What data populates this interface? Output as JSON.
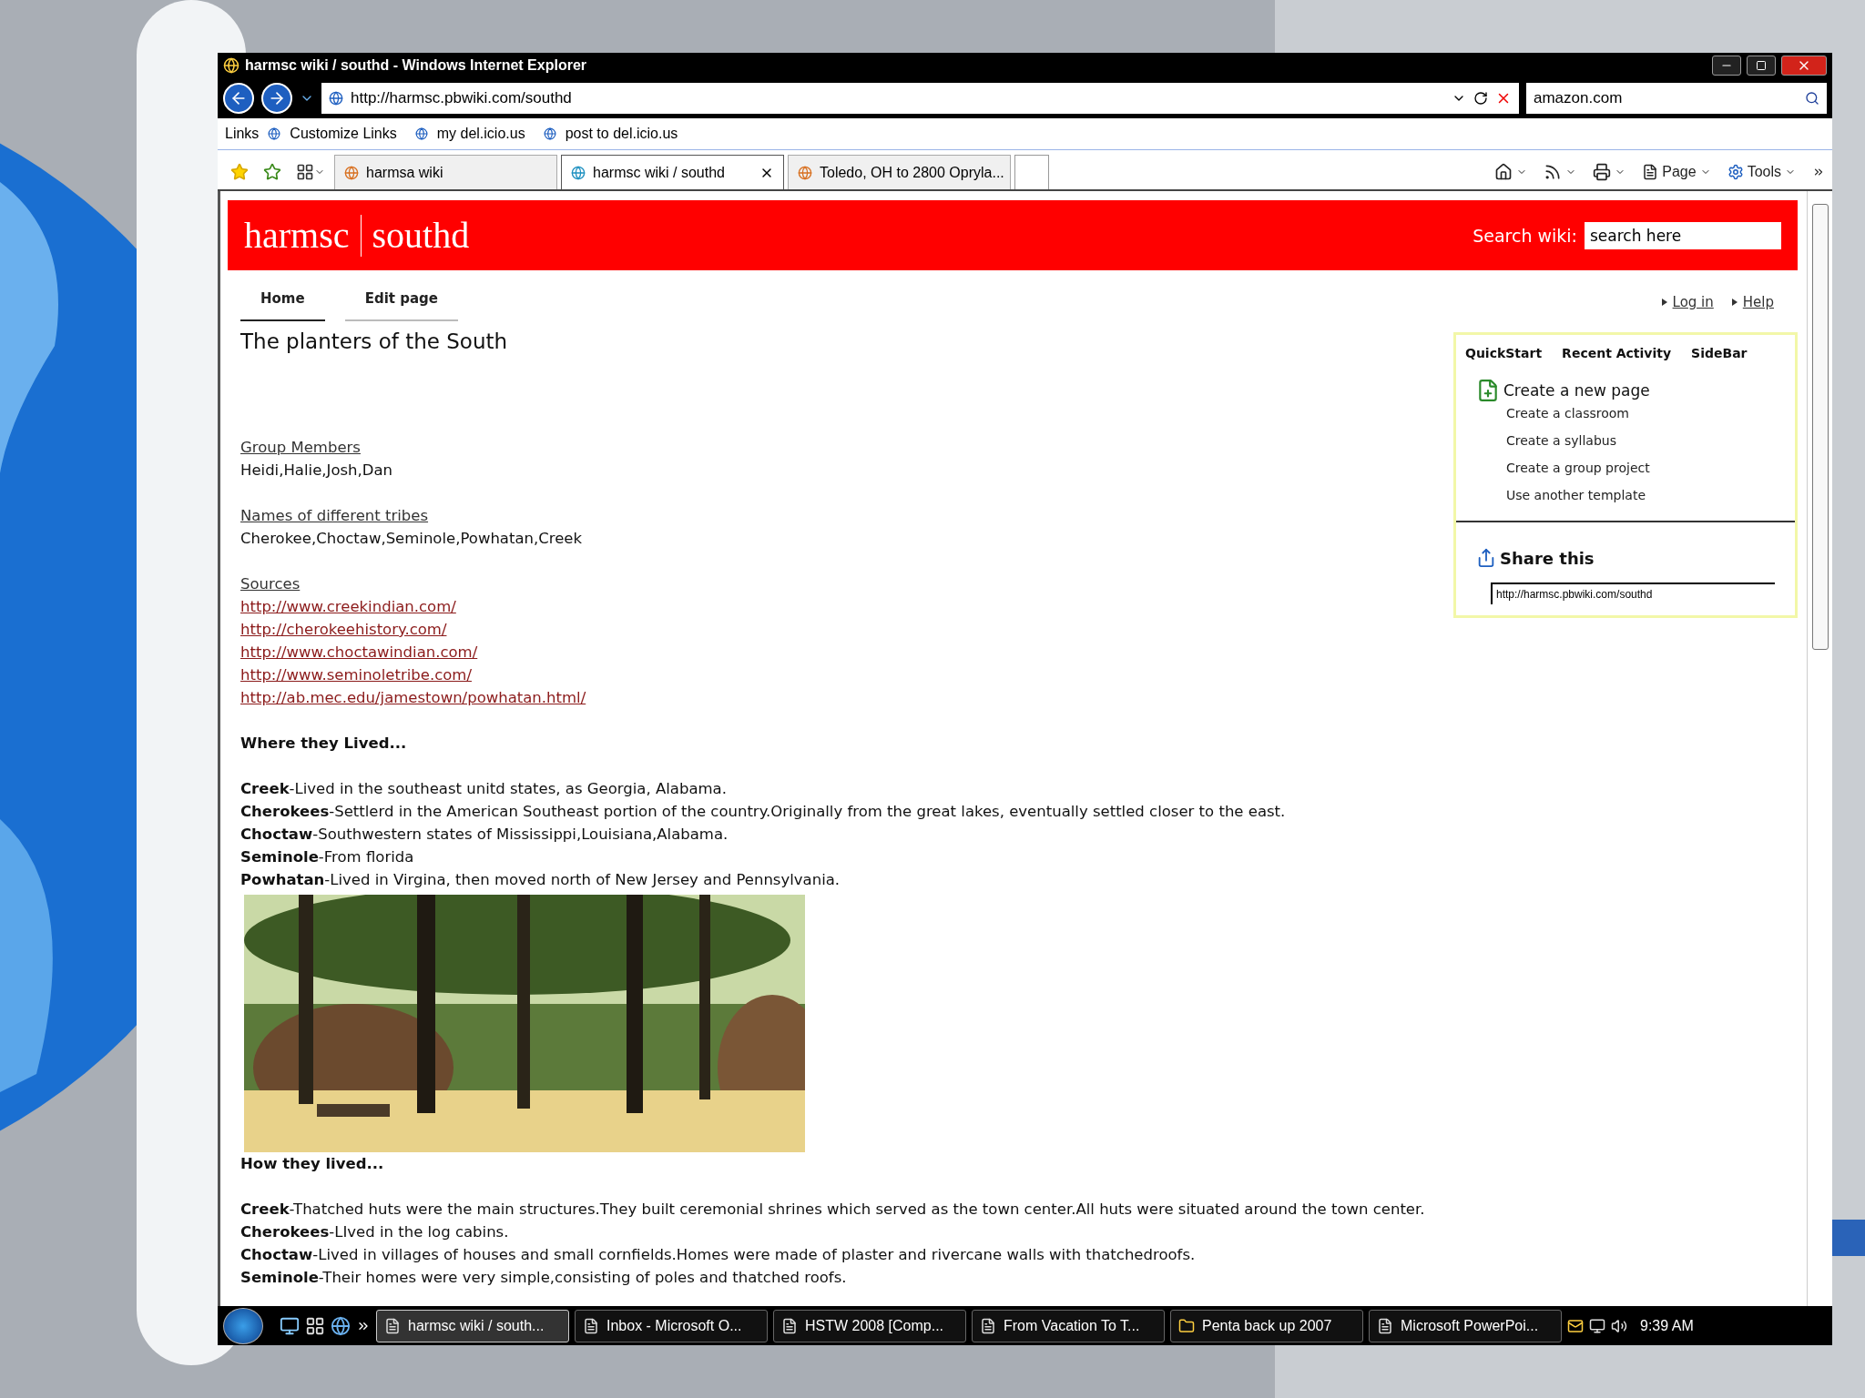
{
  "window": {
    "title": "harmsc wiki / southd - Windows Internet Explorer"
  },
  "address_bar": {
    "url": "http://harmsc.pbwiki.com/southd",
    "search_value": "amazon.com"
  },
  "links_bar": {
    "label": "Links",
    "links": [
      "Customize Links",
      "my del.icio.us",
      "post to del.icio.us"
    ]
  },
  "tabs": [
    {
      "label": "harmsa wiki",
      "selected": false
    },
    {
      "label": "harmsc wiki / southd",
      "selected": true
    },
    {
      "label": "Toledo, OH to 2800 Opryla...",
      "selected": false
    }
  ],
  "command_bar": {
    "page": "Page",
    "tools": "Tools"
  },
  "wiki": {
    "site": "harmsc",
    "page": "southd",
    "search_label": "Search wiki:",
    "search_value": "search here"
  },
  "nav": [
    {
      "label": "Home",
      "selected": true
    },
    {
      "label": "Edit page",
      "selected": false
    }
  ],
  "user_links": [
    "Log in",
    "Help"
  ],
  "title": "The planters of the South",
  "sections": [
    [
      {
        "kind": "label",
        "text": "Group Members"
      },
      {
        "kind": "text",
        "text": "Heidi,Halie,Josh,Dan"
      }
    ],
    [
      {
        "kind": "label",
        "text": "Names of different tribes"
      },
      {
        "kind": "text",
        "text": "Cherokee,Choctaw,Seminole,Powhatan,Creek"
      }
    ],
    [
      {
        "kind": "label",
        "text": "Sources"
      },
      {
        "kind": "link",
        "text": "http://www.creekindian.com/"
      },
      {
        "kind": "link",
        "text": "http://cherokeehistory.com/"
      },
      {
        "kind": "link",
        "text": "http://www.choctawindian.com/"
      },
      {
        "kind": "link",
        "text": "http://www.seminoletribe.com/"
      },
      {
        "kind": "link",
        "text": "http://ab.mec.edu/jamestown/powhatan.html/"
      }
    ],
    [
      {
        "kind": "heading",
        "text": "Where they Lived..."
      }
    ],
    [
      {
        "kind": "text",
        "text": "**Creek**-Lived in the southeast unitd states, as Georgia, Alabama."
      },
      {
        "kind": "text",
        "text": "**Cherokees**-Settlerd in the American Southeast portion of the country.Originally from the great lakes, eventually settled closer to the east."
      },
      {
        "kind": "text",
        "text": "**Choctaw**-Southwestern states of Mississippi,Louisiana,Alabama."
      },
      {
        "kind": "text",
        "text": "**Seminole**-From florida"
      },
      {
        "kind": "text",
        "text": "**Powhatan**-Lived in Virgina, then moved north of New Jersey and Pennsylvania."
      },
      {
        "kind": "picture"
      },
      {
        "kind": "heading",
        "text": "How they lived..."
      }
    ],
    [
      {
        "kind": "text",
        "text": "**Creek**-Thatched huts were the main structures.They built ceremonial shrines which served as the town center.All huts were situated around the town center."
      },
      {
        "kind": "text",
        "text": "**Cherokees**-LIved in the log cabins."
      },
      {
        "kind": "text",
        "text": "**Choctaw**-Lived in villages of houses and small cornfields.Homes were made of plaster and rivercane walls with thatchedroofs."
      },
      {
        "kind": "text",
        "text": "**Seminole**-Their homes were very simple,consisting of poles and thatched roofs."
      }
    ]
  ],
  "sidebar": {
    "tabs": [
      "QuickStart",
      "Recent Activity",
      "SideBar"
    ],
    "create_title": "Create a new page",
    "create_links": [
      "Create a classroom",
      "Create a syllabus",
      "Create a group project",
      "Use another template"
    ],
    "share_title": "Share this",
    "share_url": "http://harmsc.pbwiki.com/southd"
  },
  "taskbar": {
    "tasks": [
      {
        "label": "harmsc wiki / south...",
        "selected": true
      },
      {
        "label": "Inbox - Microsoft O...",
        "selected": false
      },
      {
        "label": "HSTW 2008 [Comp...",
        "selected": false
      },
      {
        "label": "From Vacation To T...",
        "selected": false
      },
      {
        "label": "Penta back up 2007",
        "selected": false
      },
      {
        "label": "Microsoft PowerPoi...",
        "selected": false
      }
    ],
    "time": "9:39 AM"
  }
}
